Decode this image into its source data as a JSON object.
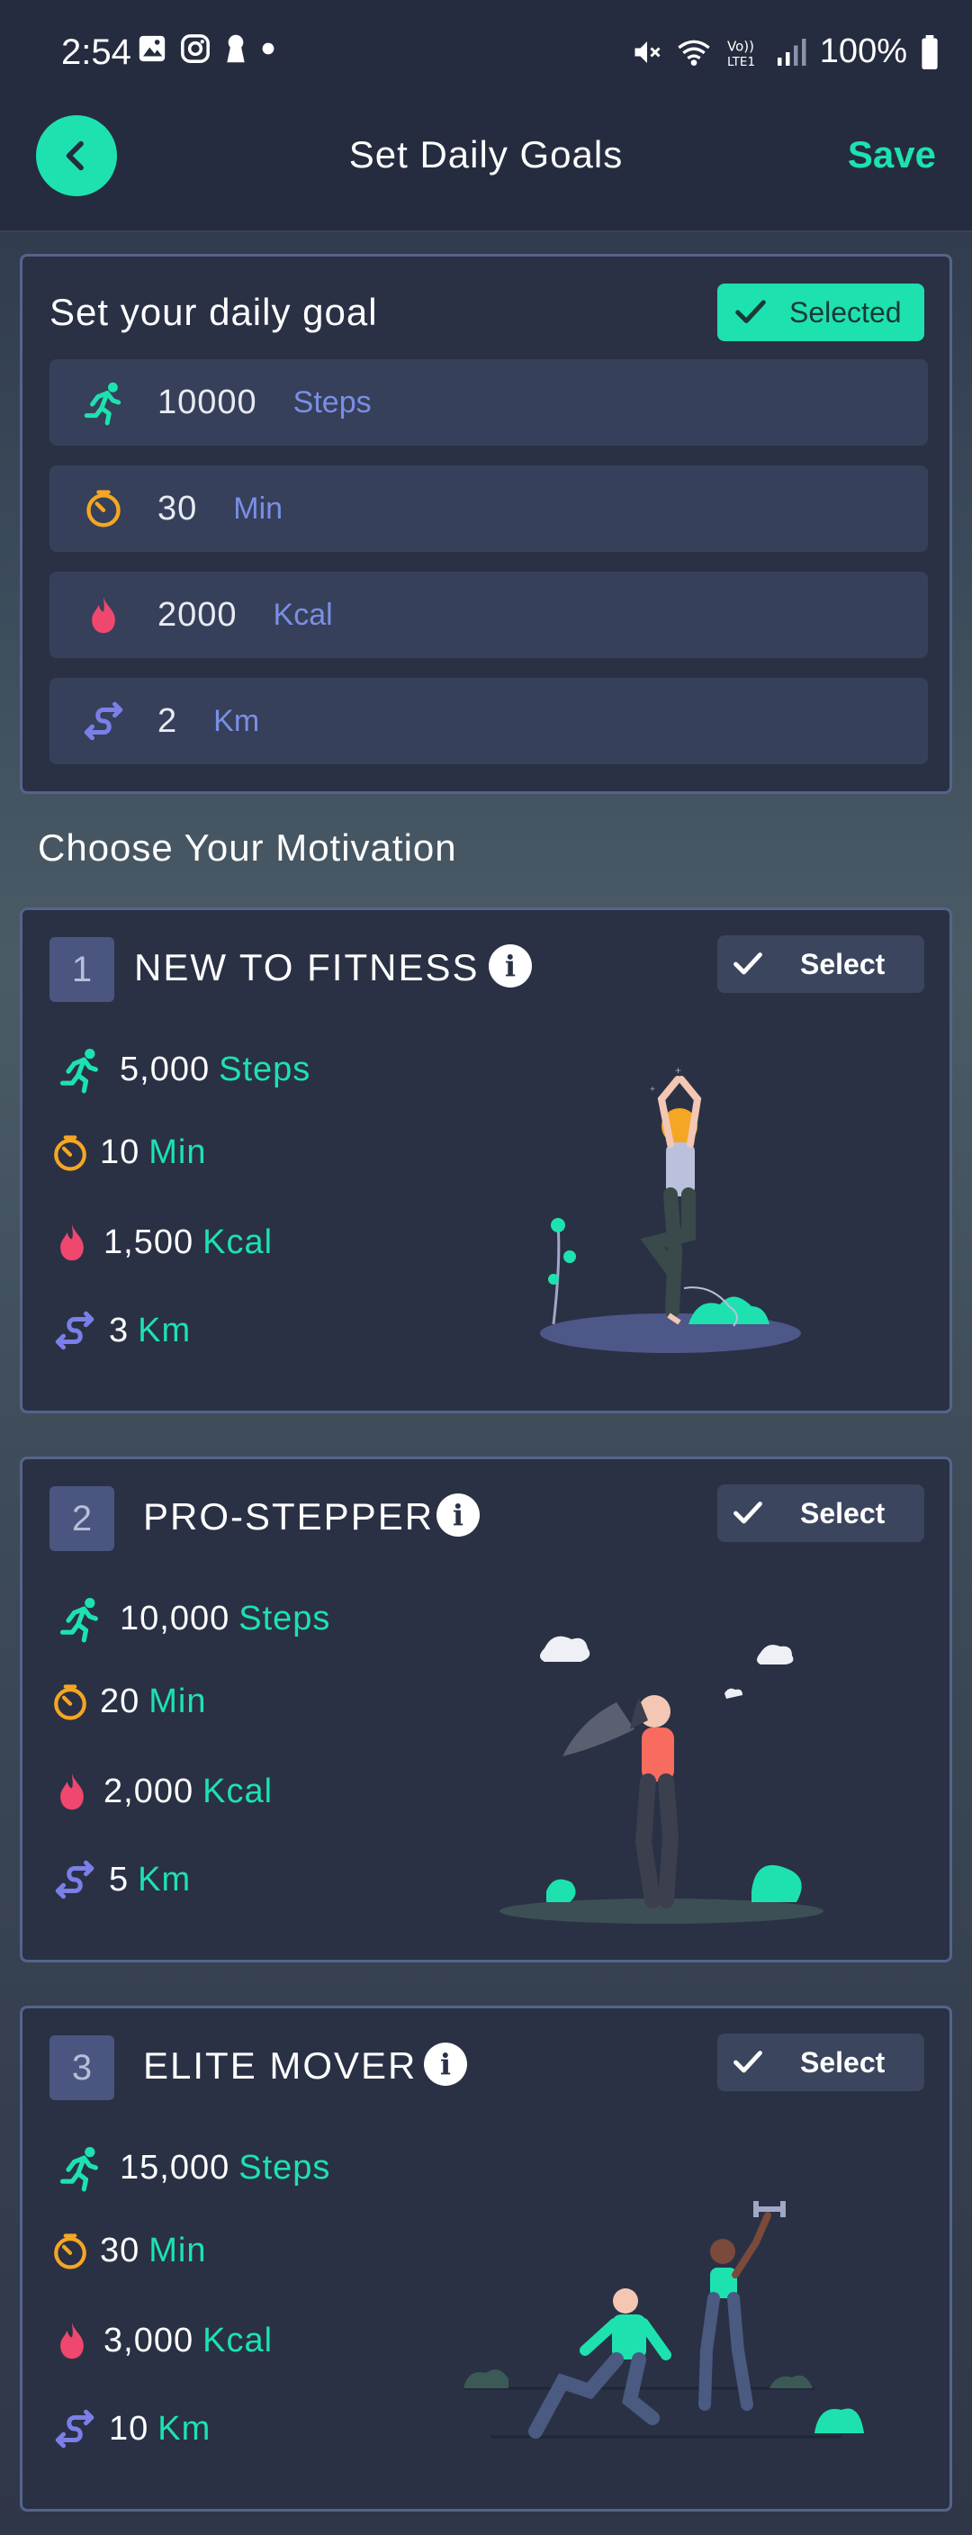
{
  "status_bar": {
    "time": "2:54",
    "battery": "100%"
  },
  "header": {
    "title": "Set Daily Goals",
    "save_label": "Save"
  },
  "goal_card": {
    "title": "Set your daily goal",
    "selected_label": "Selected",
    "rows": [
      {
        "icon": "run-icon",
        "value": "10000",
        "unit": "Steps"
      },
      {
        "icon": "timer-icon",
        "value": "30",
        "unit": "Min"
      },
      {
        "icon": "flame-icon",
        "value": "2000",
        "unit": "Kcal"
      },
      {
        "icon": "route-icon",
        "value": "2",
        "unit": "Km"
      }
    ]
  },
  "motivation": {
    "title": "Choose Your Motivation",
    "select_label": "Select",
    "plans": [
      {
        "number": "1",
        "name": "NEW TO FITNESS",
        "steps": "5,000",
        "min": "10",
        "kcal": "1,500",
        "km": "3"
      },
      {
        "number": "2",
        "name": "PRO-STEPPER",
        "steps": "10,000",
        "min": "20",
        "kcal": "2,000",
        "km": "5"
      },
      {
        "number": "3",
        "name": "ELITE MOVER",
        "steps": "15,000",
        "min": "30",
        "kcal": "3,000",
        "km": "10"
      }
    ],
    "units": {
      "steps": "Steps",
      "min": "Min",
      "kcal": "Kcal",
      "km": "Km"
    }
  },
  "colors": {
    "accent": "#1de2b0",
    "timer": "#f5a623",
    "flame": "#f0476f",
    "route": "#7b7fe8",
    "unit_blue": "#7b8ee6"
  }
}
